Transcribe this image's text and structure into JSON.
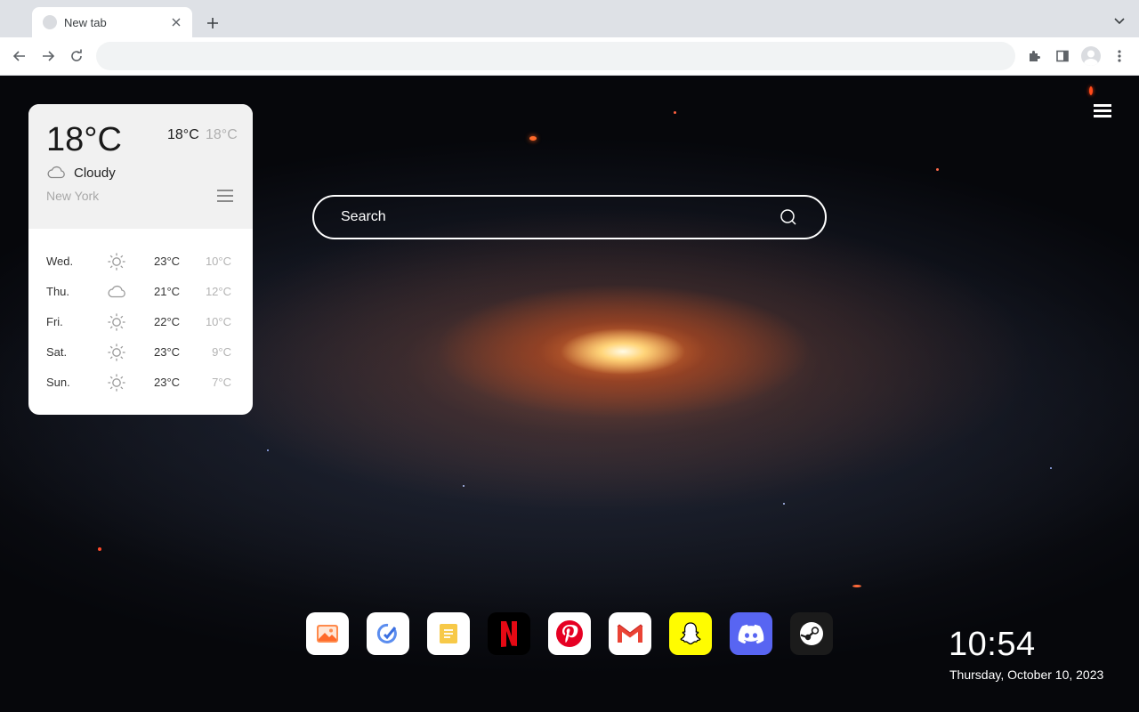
{
  "browser": {
    "tab_title": "New tab",
    "omnibox_value": "",
    "omnibox_placeholder": ""
  },
  "weather": {
    "current_temp": "18°C",
    "high": "18°C",
    "low": "18°C",
    "condition": "Cloudy",
    "condition_icon": "cloud-icon",
    "city": "New York",
    "forecast": [
      {
        "day": "Wed.",
        "icon": "sun-icon",
        "high": "23°C",
        "low": "10°C"
      },
      {
        "day": "Thu.",
        "icon": "cloud-icon",
        "high": "21°C",
        "low": "12°C"
      },
      {
        "day": "Fri.",
        "icon": "sun-icon",
        "high": "22°C",
        "low": "10°C"
      },
      {
        "day": "Sat.",
        "icon": "sun-icon",
        "high": "23°C",
        "low": "9°C"
      },
      {
        "day": "Sun.",
        "icon": "sun-icon",
        "high": "23°C",
        "low": "7°C"
      }
    ]
  },
  "search": {
    "placeholder": "Search"
  },
  "dock": {
    "apps": [
      {
        "name": "Gallery",
        "icon": "gallery-icon",
        "color": "#ffffff"
      },
      {
        "name": "Tasks",
        "icon": "tasks-icon",
        "color": "#ffffff"
      },
      {
        "name": "Notes",
        "icon": "notes-icon",
        "color": "#ffffff"
      },
      {
        "name": "Netflix",
        "icon": "netflix-icon",
        "color": "#000000"
      },
      {
        "name": "Pinterest",
        "icon": "pinterest-icon",
        "color": "#ffffff"
      },
      {
        "name": "Gmail",
        "icon": "gmail-icon",
        "color": "#ffffff"
      },
      {
        "name": "Snapchat",
        "icon": "snapchat-icon",
        "color": "#fffc00"
      },
      {
        "name": "Discord",
        "icon": "discord-icon",
        "color": "#5865f2"
      },
      {
        "name": "Steam",
        "icon": "steam-icon",
        "color": "#1b1b1b"
      }
    ]
  },
  "clock": {
    "time": "10:54",
    "date": "Thursday, October 10, 2023"
  }
}
